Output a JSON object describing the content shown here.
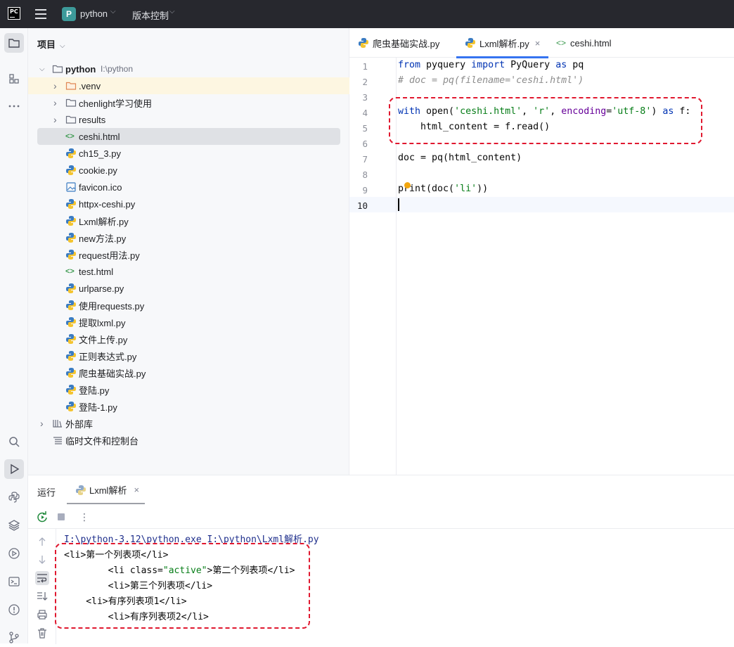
{
  "titlebar": {
    "logo": "PC",
    "project_initial": "P",
    "project_name": "python",
    "vcs_label": "版本控制"
  },
  "project_panel": {
    "header": "项目",
    "root_name": "python",
    "root_path": "I:\\python",
    "items": [
      {
        "label": ".venv",
        "type": "folder-orange"
      },
      {
        "label": "chenlight学习使用",
        "type": "folder"
      },
      {
        "label": "results",
        "type": "folder"
      },
      {
        "label": "ceshi.html",
        "type": "html"
      },
      {
        "label": "ch15_3.py",
        "type": "py"
      },
      {
        "label": "cookie.py",
        "type": "py"
      },
      {
        "label": "favicon.ico",
        "type": "img"
      },
      {
        "label": "httpx-ceshi.py",
        "type": "py"
      },
      {
        "label": "Lxml解析.py",
        "type": "py"
      },
      {
        "label": "new方法.py",
        "type": "py"
      },
      {
        "label": "request用法.py",
        "type": "py"
      },
      {
        "label": "test.html",
        "type": "html"
      },
      {
        "label": "urlparse.py",
        "type": "py"
      },
      {
        "label": "使用requests.py",
        "type": "py"
      },
      {
        "label": "提取lxml.py",
        "type": "py"
      },
      {
        "label": "文件上传.py",
        "type": "py"
      },
      {
        "label": "正则表达式.py",
        "type": "py"
      },
      {
        "label": "爬虫基础实战.py",
        "type": "py"
      },
      {
        "label": "登陆.py",
        "type": "py"
      },
      {
        "label": "登陆-1.py",
        "type": "py"
      }
    ],
    "external_libs": "外部库",
    "scratches": "临时文件和控制台"
  },
  "editor": {
    "tabs": [
      {
        "label": "爬虫基础实战.py"
      },
      {
        "label": "Lxml解析.py",
        "close": "×"
      },
      {
        "label": "ceshi.html"
      }
    ],
    "line_numbers": [
      "1",
      "2",
      "3",
      "4",
      "5",
      "6",
      "7",
      "8",
      "9",
      "10"
    ],
    "code": {
      "l1_from": "from",
      "l1_mod": " pyquery ",
      "l1_import": "import",
      "l1_cls": " PyQuery ",
      "l1_as": "as",
      "l1_pq": " pq",
      "l2": "# doc = pq(filename='ceshi.html')",
      "l4_with": "with",
      "l4_open": " open(",
      "l4_s1": "'ceshi.html'",
      "l4_c1": ", ",
      "l4_s2": "'r'",
      "l4_c2": ", ",
      "l4_enc": "encoding",
      "l4_eq": "=",
      "l4_s3": "'utf-8'",
      "l4_close": ") ",
      "l4_as": "as",
      "l4_f": " f:",
      "l5": "    html_content = f.read()",
      "l7": "doc = pq(html_content)",
      "l9_a": "print(doc(",
      "l9_s": "'li'",
      "l9_b": "))"
    }
  },
  "run_panel": {
    "title": "运行",
    "tab_label": "Lxml解析",
    "tab_close": "×",
    "more": "⋮",
    "console": {
      "cmd": "I:\\python-3.12\\python.exe I:\\python\\Lxml解析.py",
      "l1": "<li>第一个列表项</li>",
      "l2_a": "        <li class=",
      "l2_s": "\"active\"",
      "l2_b": ">第二个列表项</li>",
      "l3": "        <li>第三个列表项</li>",
      "l4": "    <li>有序列表项1</li>",
      "l5": "        <li>有序列表项2</li>"
    }
  },
  "colors": {
    "accent": "#3574f0",
    "annotation_red": "#e0182f",
    "string_green": "#067d17",
    "keyword_blue": "#0033b3"
  }
}
